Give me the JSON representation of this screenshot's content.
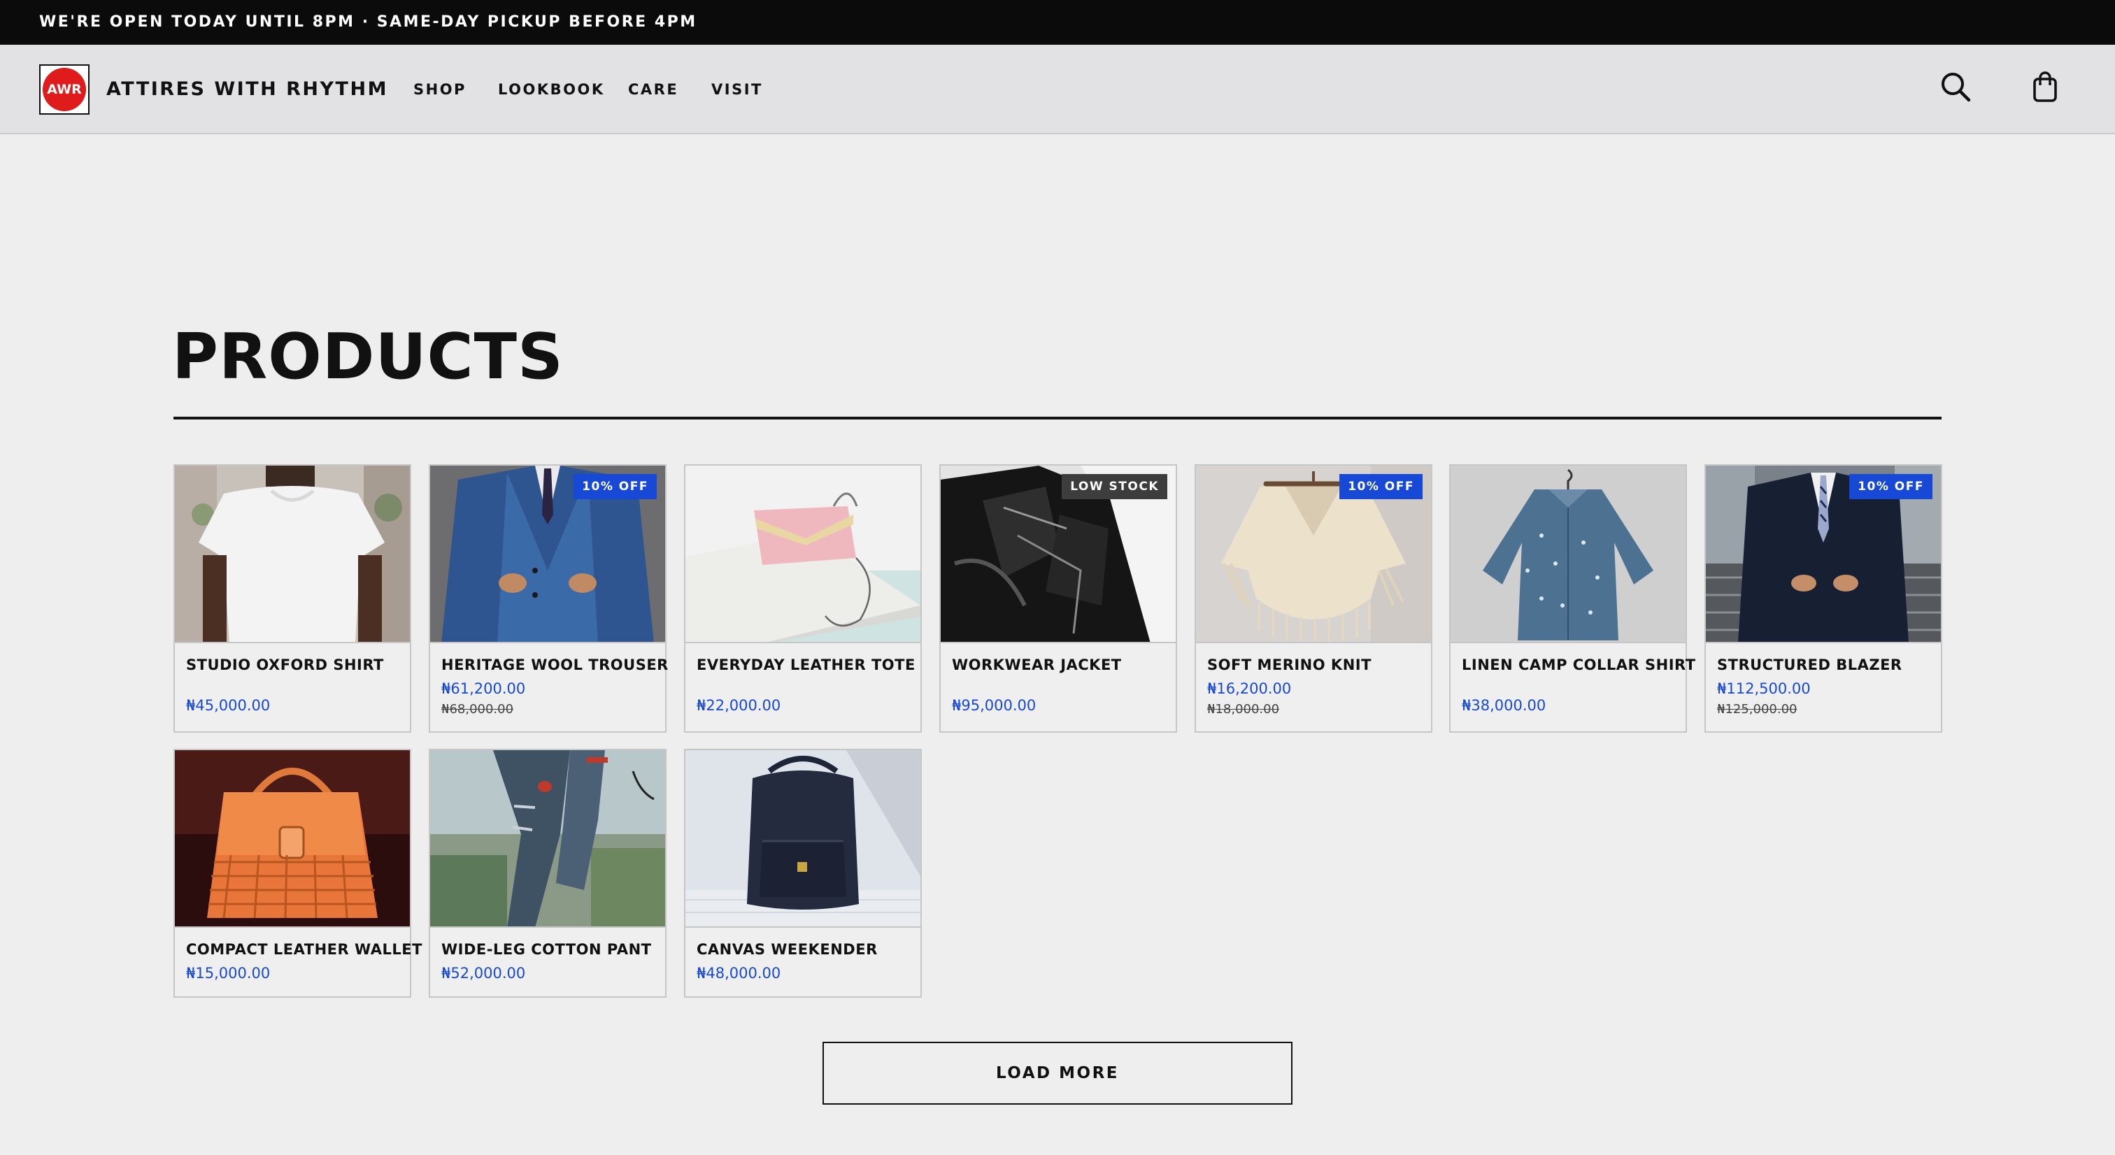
{
  "announcement": "WE'RE OPEN TODAY UNTIL 8PM · SAME-DAY PICKUP BEFORE 4PM",
  "header": {
    "logo_text": "AWR",
    "brand": "ATTIRES WITH RHYTHM",
    "nav": [
      "SHOP",
      "LOOKBOOK",
      "CARE",
      "VISIT"
    ],
    "icons": [
      "search-icon",
      "shopping-bag-icon"
    ]
  },
  "page": {
    "title": "PRODUCTS"
  },
  "products": [
    {
      "name": "STUDIO OXFORD SHIRT",
      "price": "₦45,000.00",
      "old_price": "",
      "badge": ""
    },
    {
      "name": "HERITAGE WOOL TROUSER",
      "price": "₦61,200.00",
      "old_price": "₦68,000.00",
      "badge": "10% OFF"
    },
    {
      "name": "EVERYDAY LEATHER TOTE",
      "price": "₦22,000.00",
      "old_price": "",
      "badge": ""
    },
    {
      "name": "WORKWEAR JACKET",
      "price": "₦95,000.00",
      "old_price": "",
      "badge": "LOW STOCK"
    },
    {
      "name": "SOFT MERINO KNIT",
      "price": "₦16,200.00",
      "old_price": "₦18,000.00",
      "badge": "10% OFF"
    },
    {
      "name": "LINEN CAMP COLLAR SHIRT",
      "price": "₦38,000.00",
      "old_price": "",
      "badge": ""
    },
    {
      "name": "STRUCTURED BLAZER",
      "price": "₦112,500.00",
      "old_price": "₦125,000.00",
      "badge": "10% OFF"
    },
    {
      "name": "COMPACT LEATHER WALLET",
      "price": "₦15,000.00",
      "old_price": "",
      "badge": ""
    },
    {
      "name": "WIDE-LEG COTTON PANT",
      "price": "₦52,000.00",
      "old_price": "",
      "badge": ""
    },
    {
      "name": "CANVAS WEEKENDER",
      "price": "₦48,000.00",
      "old_price": "",
      "badge": ""
    }
  ],
  "load_more": "LOAD MORE",
  "colors": {
    "accent_blue": "#1749d6",
    "logo_red": "#e01b1b",
    "announcement_bg": "#0b0b0b",
    "header_bg": "#e2e2e4",
    "page_bg": "#eeeeee",
    "low_stock_badge": "#3d3d3d"
  }
}
